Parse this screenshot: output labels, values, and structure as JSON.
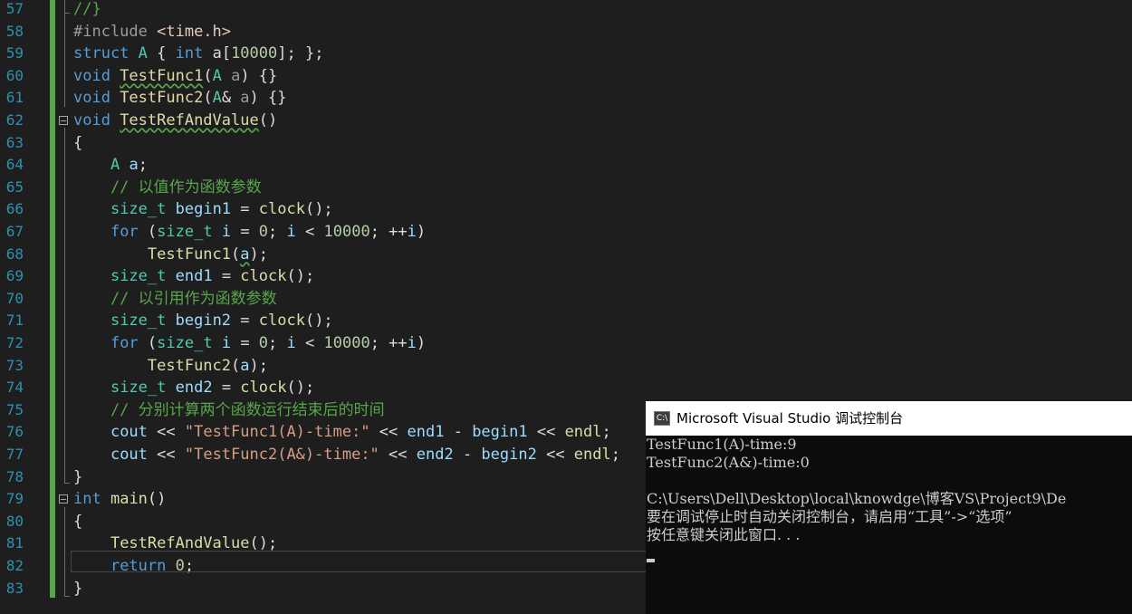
{
  "editor": {
    "lines": [
      {
        "n": "57",
        "segs": [
          {
            "t": "//}",
            "c": "cm"
          }
        ]
      },
      {
        "n": "58",
        "segs": [
          {
            "t": "#include ",
            "c": "pp"
          },
          {
            "t": "<time.h>",
            "c": "inc"
          }
        ]
      },
      {
        "n": "59",
        "segs": [
          {
            "t": "struct ",
            "c": "kw"
          },
          {
            "t": "A",
            "c": "ty"
          },
          {
            "t": " { ",
            "c": ""
          },
          {
            "t": "int",
            "c": "kw"
          },
          {
            "t": " a[",
            "c": ""
          },
          {
            "t": "10000",
            "c": "num"
          },
          {
            "t": "]; };",
            "c": ""
          }
        ]
      },
      {
        "n": "60",
        "segs": [
          {
            "t": "void ",
            "c": "kw"
          },
          {
            "t": "TestFunc1",
            "c": "fn wavy"
          },
          {
            "t": "(",
            "c": ""
          },
          {
            "t": "A",
            "c": "ty"
          },
          {
            "t": " ",
            "c": ""
          },
          {
            "t": "a",
            "c": "par"
          },
          {
            "t": ") {}",
            "c": ""
          }
        ]
      },
      {
        "n": "61",
        "segs": [
          {
            "t": "void ",
            "c": "kw"
          },
          {
            "t": "TestFunc2",
            "c": "fn"
          },
          {
            "t": "(",
            "c": ""
          },
          {
            "t": "A",
            "c": "ty"
          },
          {
            "t": "& ",
            "c": ""
          },
          {
            "t": "a",
            "c": "par"
          },
          {
            "t": ") {}",
            "c": ""
          }
        ]
      },
      {
        "n": "62",
        "fold": true,
        "segs": [
          {
            "t": "void ",
            "c": "kw"
          },
          {
            "t": "TestRefAndValue",
            "c": "fn wavy"
          },
          {
            "t": "()",
            "c": ""
          }
        ]
      },
      {
        "n": "63",
        "segs": [
          {
            "t": "{",
            "c": ""
          }
        ]
      },
      {
        "n": "64",
        "segs": [
          {
            "t": "    ",
            "c": ""
          },
          {
            "t": "A",
            "c": "ty"
          },
          {
            "t": " ",
            "c": ""
          },
          {
            "t": "a",
            "c": "var"
          },
          {
            "t": ";",
            "c": ""
          }
        ]
      },
      {
        "n": "65",
        "segs": [
          {
            "t": "    // 以值作为函数参数",
            "c": "cm"
          }
        ]
      },
      {
        "n": "66",
        "segs": [
          {
            "t": "    ",
            "c": ""
          },
          {
            "t": "size_t",
            "c": "ty"
          },
          {
            "t": " ",
            "c": ""
          },
          {
            "t": "begin1",
            "c": "var"
          },
          {
            "t": " = ",
            "c": ""
          },
          {
            "t": "clock",
            "c": "fn"
          },
          {
            "t": "();",
            "c": ""
          }
        ]
      },
      {
        "n": "67",
        "segs": [
          {
            "t": "    ",
            "c": ""
          },
          {
            "t": "for",
            "c": "kw"
          },
          {
            "t": " (",
            "c": ""
          },
          {
            "t": "size_t",
            "c": "ty"
          },
          {
            "t": " ",
            "c": ""
          },
          {
            "t": "i",
            "c": "var"
          },
          {
            "t": " = ",
            "c": ""
          },
          {
            "t": "0",
            "c": "num"
          },
          {
            "t": "; ",
            "c": ""
          },
          {
            "t": "i",
            "c": "var"
          },
          {
            "t": " < ",
            "c": ""
          },
          {
            "t": "10000",
            "c": "num"
          },
          {
            "t": "; ++",
            "c": ""
          },
          {
            "t": "i",
            "c": "var"
          },
          {
            "t": ")",
            "c": ""
          }
        ]
      },
      {
        "n": "68",
        "segs": [
          {
            "t": "        ",
            "c": ""
          },
          {
            "t": "TestFunc1",
            "c": "fn"
          },
          {
            "t": "(",
            "c": ""
          },
          {
            "t": "a",
            "c": "var wavy"
          },
          {
            "t": ");",
            "c": ""
          }
        ]
      },
      {
        "n": "69",
        "segs": [
          {
            "t": "    ",
            "c": ""
          },
          {
            "t": "size_t",
            "c": "ty"
          },
          {
            "t": " ",
            "c": ""
          },
          {
            "t": "end1",
            "c": "var"
          },
          {
            "t": " = ",
            "c": ""
          },
          {
            "t": "clock",
            "c": "fn"
          },
          {
            "t": "();",
            "c": ""
          }
        ]
      },
      {
        "n": "70",
        "segs": [
          {
            "t": "    // 以引用作为函数参数",
            "c": "cm"
          }
        ]
      },
      {
        "n": "71",
        "segs": [
          {
            "t": "    ",
            "c": ""
          },
          {
            "t": "size_t",
            "c": "ty"
          },
          {
            "t": " ",
            "c": ""
          },
          {
            "t": "begin2",
            "c": "var"
          },
          {
            "t": " = ",
            "c": ""
          },
          {
            "t": "clock",
            "c": "fn"
          },
          {
            "t": "();",
            "c": ""
          }
        ]
      },
      {
        "n": "72",
        "segs": [
          {
            "t": "    ",
            "c": ""
          },
          {
            "t": "for",
            "c": "kw"
          },
          {
            "t": " (",
            "c": ""
          },
          {
            "t": "size_t",
            "c": "ty"
          },
          {
            "t": " ",
            "c": ""
          },
          {
            "t": "i",
            "c": "var"
          },
          {
            "t": " = ",
            "c": ""
          },
          {
            "t": "0",
            "c": "num"
          },
          {
            "t": "; ",
            "c": ""
          },
          {
            "t": "i",
            "c": "var"
          },
          {
            "t": " < ",
            "c": ""
          },
          {
            "t": "10000",
            "c": "num"
          },
          {
            "t": "; ++",
            "c": ""
          },
          {
            "t": "i",
            "c": "var"
          },
          {
            "t": ")",
            "c": ""
          }
        ]
      },
      {
        "n": "73",
        "segs": [
          {
            "t": "        ",
            "c": ""
          },
          {
            "t": "TestFunc2",
            "c": "fn"
          },
          {
            "t": "(",
            "c": ""
          },
          {
            "t": "a",
            "c": "var"
          },
          {
            "t": ");",
            "c": ""
          }
        ]
      },
      {
        "n": "74",
        "segs": [
          {
            "t": "    ",
            "c": ""
          },
          {
            "t": "size_t",
            "c": "ty"
          },
          {
            "t": " ",
            "c": ""
          },
          {
            "t": "end2",
            "c": "var"
          },
          {
            "t": " = ",
            "c": ""
          },
          {
            "t": "clock",
            "c": "fn"
          },
          {
            "t": "();",
            "c": ""
          }
        ]
      },
      {
        "n": "75",
        "segs": [
          {
            "t": "    // 分别计算两个函数运行结束后的时间",
            "c": "cm"
          }
        ]
      },
      {
        "n": "76",
        "segs": [
          {
            "t": "    ",
            "c": ""
          },
          {
            "t": "cout",
            "c": "var"
          },
          {
            "t": " << ",
            "c": ""
          },
          {
            "t": "\"TestFunc1(A)-time:\"",
            "c": "str"
          },
          {
            "t": " << ",
            "c": ""
          },
          {
            "t": "end1",
            "c": "var"
          },
          {
            "t": " - ",
            "c": ""
          },
          {
            "t": "begin1",
            "c": "var"
          },
          {
            "t": " << ",
            "c": ""
          },
          {
            "t": "endl",
            "c": "fn"
          },
          {
            "t": ";",
            "c": ""
          }
        ]
      },
      {
        "n": "77",
        "segs": [
          {
            "t": "    ",
            "c": ""
          },
          {
            "t": "cout",
            "c": "var"
          },
          {
            "t": " << ",
            "c": ""
          },
          {
            "t": "\"TestFunc2(A&)-time:\"",
            "c": "str"
          },
          {
            "t": " << ",
            "c": ""
          },
          {
            "t": "end2",
            "c": "var"
          },
          {
            "t": " - ",
            "c": ""
          },
          {
            "t": "begin2",
            "c": "var"
          },
          {
            "t": " << ",
            "c": ""
          },
          {
            "t": "endl",
            "c": "fn"
          },
          {
            "t": ";",
            "c": ""
          }
        ]
      },
      {
        "n": "78",
        "segs": [
          {
            "t": "}",
            "c": ""
          }
        ]
      },
      {
        "n": "79",
        "fold": true,
        "segs": [
          {
            "t": "int",
            "c": "kw"
          },
          {
            "t": " ",
            "c": ""
          },
          {
            "t": "main",
            "c": "fn"
          },
          {
            "t": "()",
            "c": ""
          }
        ]
      },
      {
        "n": "80",
        "segs": [
          {
            "t": "{",
            "c": ""
          }
        ]
      },
      {
        "n": "81",
        "segs": [
          {
            "t": "    ",
            "c": ""
          },
          {
            "t": "TestRefAndValue",
            "c": "fn"
          },
          {
            "t": "();",
            "c": ""
          }
        ]
      },
      {
        "n": "82",
        "segs": [
          {
            "t": "    ",
            "c": ""
          },
          {
            "t": "return",
            "c": "kw"
          },
          {
            "t": " ",
            "c": ""
          },
          {
            "t": "0",
            "c": "num"
          },
          {
            "t": ";",
            "c": ""
          }
        ]
      },
      {
        "n": "83",
        "segs": [
          {
            "t": "}",
            "c": ""
          }
        ]
      }
    ]
  },
  "console": {
    "title": "Microsoft Visual Studio 调试控制台",
    "icon_text": "C:\\",
    "icon": "console-app-icon",
    "lines": [
      "TestFunc1(A)-time:9",
      "TestFunc2(A&)-time:0",
      "",
      "C:\\Users\\Dell\\Desktop\\local\\knowdge\\博客VS\\Project9\\De",
      "要在调试停止时自动关闭控制台，请启用“工具”->“选项”",
      "按任意键关闭此窗口. . ."
    ]
  },
  "colors": {
    "editor_bg": "#1e1e1e",
    "keyword": "#569cd6",
    "type": "#4ec9b0",
    "function": "#dcdcaa",
    "string": "#d69d85",
    "number": "#b5cea8",
    "comment": "#57a64a",
    "line_number": "#2b91af",
    "console_bg": "#0c0c0c"
  }
}
